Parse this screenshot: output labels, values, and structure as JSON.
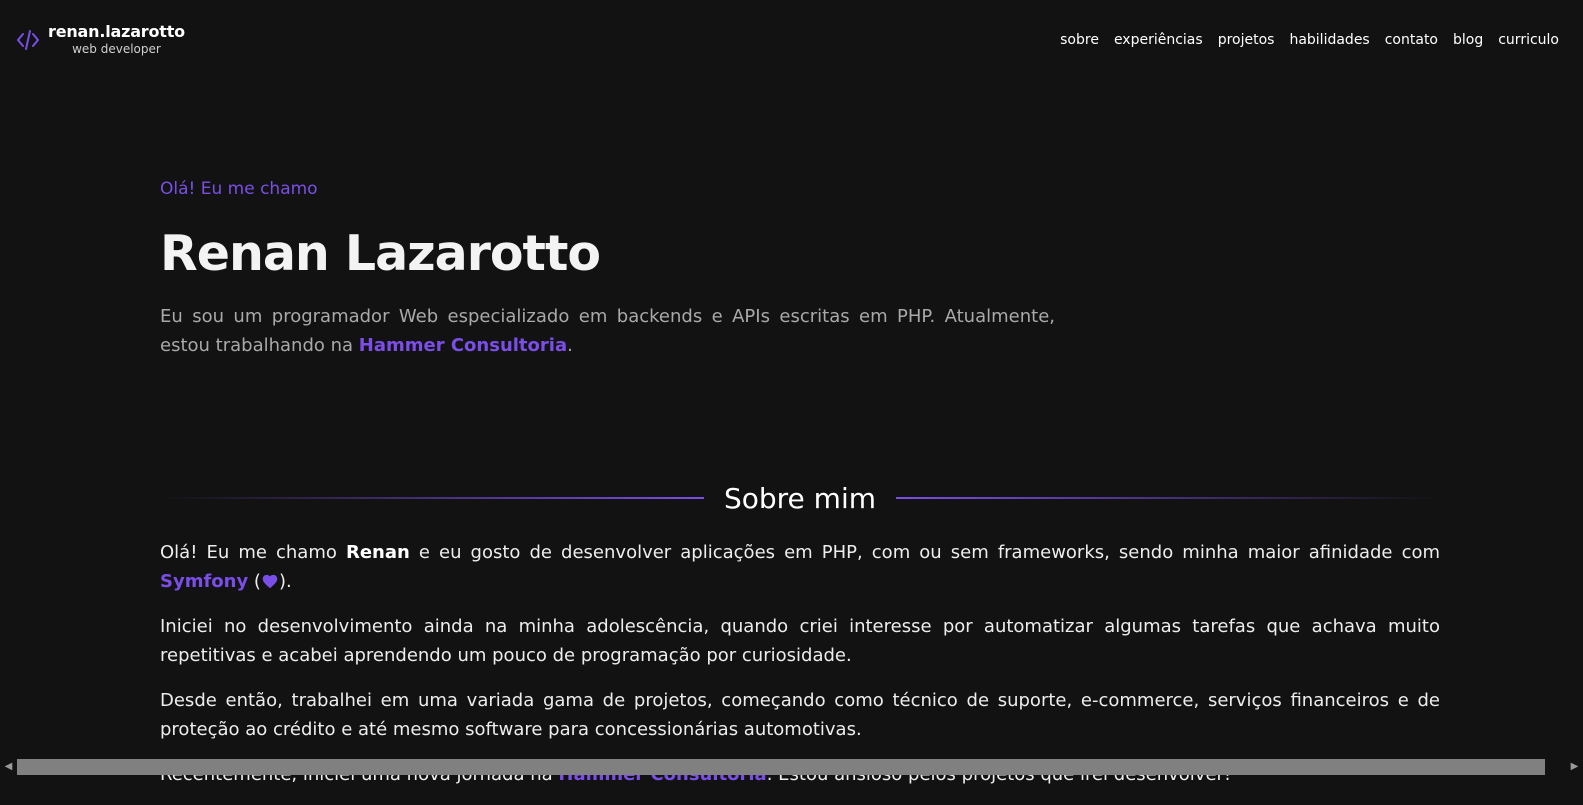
{
  "header": {
    "logo_icon": "code-icon",
    "brand_name": "renan.lazarotto",
    "brand_subtitle": "web developer",
    "nav": [
      {
        "label": "sobre"
      },
      {
        "label": "experiências"
      },
      {
        "label": "projetos"
      },
      {
        "label": "habilidades"
      },
      {
        "label": "contato"
      },
      {
        "label": "blog"
      },
      {
        "label": "curriculo"
      }
    ]
  },
  "hero": {
    "greeting": "Olá! Eu me chamo",
    "name": "Renan Lazarotto",
    "description_before": "Eu sou um programador Web especializado em backends e APIs escritas em PHP. Atualmente, estou trabalhando na ",
    "description_link": "Hammer Consultoria",
    "description_after": "."
  },
  "about": {
    "title": "Sobre mim",
    "p1": {
      "before": "Olá! Eu me chamo ",
      "name": "Renan",
      "middle": " e eu gosto de desenvolver aplicações em PHP, com ou sem frameworks, sendo minha maior afinidade com ",
      "link": "Symfony",
      "paren_open": " (",
      "paren_close": ")."
    },
    "p2": "Iniciei no desenvolvimento ainda na minha adolescência, quando criei interesse por automatizar algumas tarefas que achava muito repetitivas e acabei aprendendo um pouco de programação por curiosidade.",
    "p3": "Desde então, trabalhei em uma variada gama de projetos, começando como técnico de suporte, e-commerce, serviços financeiros e de proteção ao crédito e até mesmo software para concessionárias automotivas.",
    "p4": {
      "before": "Recentemente, iniciei uma nova jornada na ",
      "link": "Hammer Consultoria",
      "after": ". Estou ansioso pelos projetos que irei desenvolver!"
    }
  },
  "scrollbar": {
    "left_arrow": "◀",
    "right_arrow": "▶"
  },
  "colors": {
    "background": "#121212",
    "accent": "#7b4ee8",
    "text": "#eeeeee",
    "muted_text": "#a9a9a9",
    "scrollbar_thumb": "#808080"
  }
}
